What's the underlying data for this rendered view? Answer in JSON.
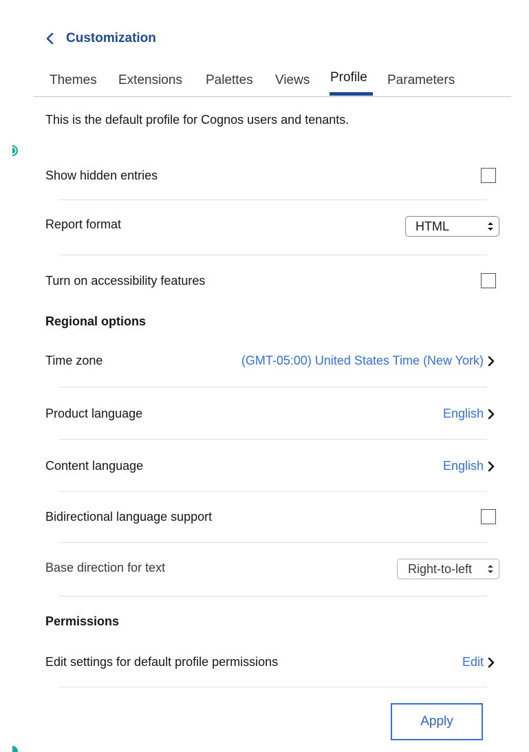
{
  "header": {
    "title": "Customization"
  },
  "tabs": [
    {
      "label": "Themes"
    },
    {
      "label": "Extensions"
    },
    {
      "label": "Palettes"
    },
    {
      "label": "Views"
    },
    {
      "label": "Profile",
      "active": true
    },
    {
      "label": "Parameters"
    }
  ],
  "intro": "This is the default profile for Cognos users and tenants.",
  "general": {
    "show_hidden_entries": {
      "label": "Show hidden entries",
      "checked": false
    },
    "report_format": {
      "label": "Report format",
      "value": "HTML"
    },
    "accessibility": {
      "label": "Turn on accessibility features",
      "checked": false
    }
  },
  "regional": {
    "title": "Regional options",
    "time_zone": {
      "label": "Time zone",
      "value": "(GMT-05:00) United States Time (New York)"
    },
    "product_language": {
      "label": "Product language",
      "value": "English"
    },
    "content_language": {
      "label": "Content language",
      "value": "English"
    },
    "bidi_support": {
      "label": "Bidirectional language support",
      "checked": false
    },
    "base_direction": {
      "label": "Base direction for text",
      "value": "Right-to-left"
    }
  },
  "permissions": {
    "title": "Permissions",
    "edit_settings": {
      "label": "Edit settings for default profile permissions",
      "value": "Edit"
    }
  },
  "apply_label": "Apply",
  "colors": {
    "title": "#1f4a8f",
    "tab_active_underline": "#1f4a8f",
    "link": "#3572d6",
    "apply_border": "#3a6fd0",
    "edge_glyph": "#1aa9a1"
  },
  "icons": {
    "back": "chevron-left-icon",
    "row_nav": "chevron-right-icon",
    "select": "select-updown-arrows-icon",
    "edge": "half-circle-icon"
  }
}
